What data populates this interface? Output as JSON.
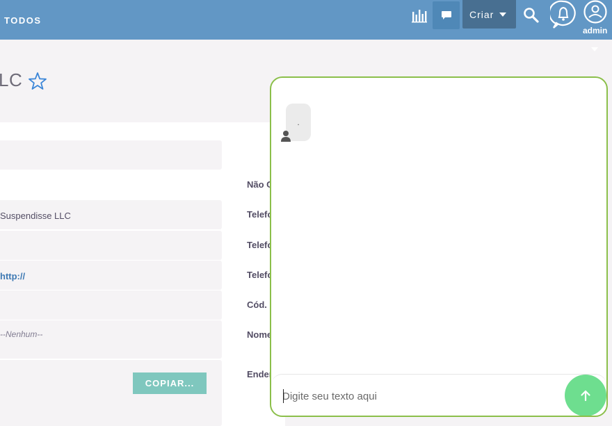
{
  "topbar": {
    "nav_all_label": "TODOS",
    "criar_label": "Criar",
    "user_label": "admin",
    "icons": [
      "bar-chart-icon",
      "chat-icon",
      "search-icon",
      "bell-icon",
      "user-icon"
    ]
  },
  "record": {
    "title_fragment": "LC",
    "fields": [
      {
        "value": ""
      },
      {
        "value": "Suspendisse LLC"
      },
      {
        "value": ""
      },
      {
        "value": "http://"
      },
      {
        "value": ""
      },
      {
        "value": "--Nenhum--"
      }
    ],
    "copy_button_label": "COPIAR...",
    "detail_labels": [
      "Não C",
      "Telefo",
      "Telefo",
      "Telefo",
      "Cód. C",
      "Nome",
      "Ender"
    ]
  },
  "chat": {
    "message_text": ".",
    "input_placeholder": "Digite seu texto aqui",
    "colors": {
      "border": "#8bbf4a",
      "send": "#6ede8f"
    }
  },
  "colors": {
    "topbar": "#6297c5",
    "criar": "#486f91",
    "copy_button": "#7fc7be"
  }
}
